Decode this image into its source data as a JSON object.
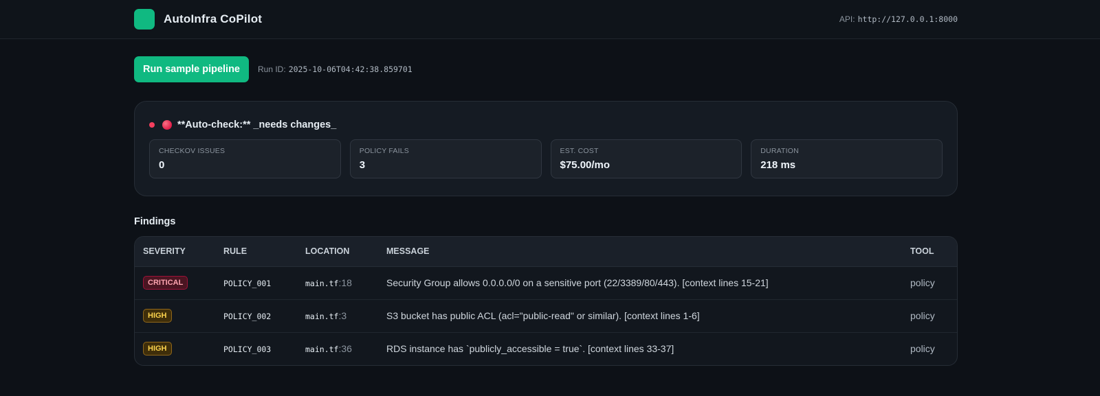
{
  "header": {
    "app_title": "AutoInfra CoPilot",
    "api_label": "API:",
    "api_url": "http://127.0.0.1:8000"
  },
  "run": {
    "button_label": "Run sample pipeline",
    "run_id_label": "Run ID:",
    "run_id": "2025-10-06T04:42:38.859701"
  },
  "summary": {
    "status_text": "**Auto-check:** _needs changes_",
    "metrics": [
      {
        "label": "CHECKOV ISSUES",
        "value": "0"
      },
      {
        "label": "POLICY FAILS",
        "value": "3"
      },
      {
        "label": "EST. COST",
        "value": "$75.00/mo"
      },
      {
        "label": "DURATION",
        "value": "218 ms"
      }
    ]
  },
  "findings": {
    "title": "Findings",
    "columns": [
      "SEVERITY",
      "RULE",
      "LOCATION",
      "MESSAGE",
      "TOOL"
    ],
    "rows": [
      {
        "severity": "CRITICAL",
        "rule": "POLICY_001",
        "file": "main.tf",
        "line": ":18",
        "message": "Security Group allows 0.0.0.0/0 on a sensitive port (22/3389/80/443). [context lines 15-21]",
        "tool": "policy"
      },
      {
        "severity": "HIGH",
        "rule": "POLICY_002",
        "file": "main.tf",
        "line": ":3",
        "message": "S3 bucket has public ACL (acl=\"public-read\" or similar). [context lines 1-6]",
        "tool": "policy"
      },
      {
        "severity": "HIGH",
        "rule": "POLICY_003",
        "file": "main.tf",
        "line": ":36",
        "message": "RDS instance has `publicly_accessible = true`. [context lines 33-37]",
        "tool": "policy"
      }
    ]
  },
  "colors": {
    "accent": "#10b981",
    "critical": "#f43f5e",
    "high": "#fcd34d",
    "background": "#0d1117"
  }
}
